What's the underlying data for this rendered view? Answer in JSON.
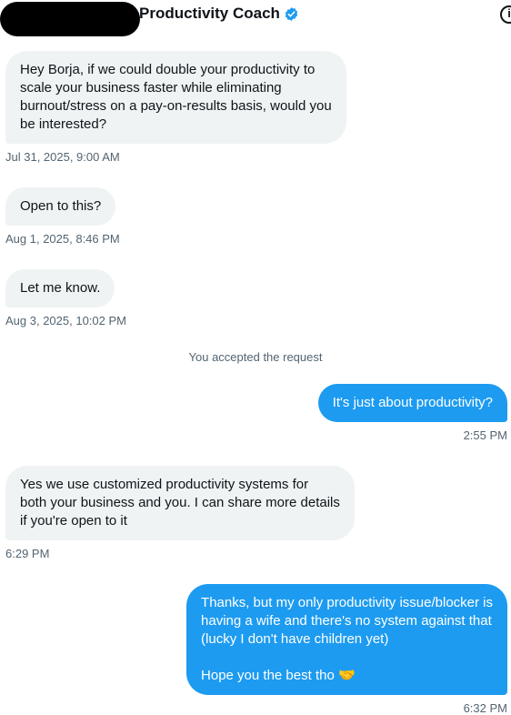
{
  "header": {
    "name": "Productivity Coach",
    "verified_icon": "verified-badge-icon",
    "info_icon": "info-icon"
  },
  "colors": {
    "accent": "#1d9bf0",
    "incoming_bg": "#eff3f4",
    "timestamp": "#536471"
  },
  "messages": [
    {
      "direction": "in",
      "lines": [
        "Hey Borja, if we could double your productivity to",
        "scale your business faster while eliminating",
        "burnout/stress on a pay-on-results basis, would you",
        "be interested?"
      ],
      "time": "Jul 31, 2025, 9:00 AM"
    },
    {
      "direction": "in",
      "lines": [
        "Open to this?"
      ],
      "time": "Aug 1, 2025, 8:46 PM"
    },
    {
      "direction": "in",
      "lines": [
        "Let me know."
      ],
      "time": "Aug 3, 2025, 10:02 PM"
    },
    {
      "system": "You accepted the request"
    },
    {
      "direction": "out",
      "lines": [
        "It's just about productivity?"
      ],
      "time": "2:55 PM"
    },
    {
      "direction": "in",
      "lines": [
        "Yes we use customized productivity systems for",
        "both your business and you. I can share more details",
        "if you're open to it"
      ],
      "time": "6:29 PM"
    },
    {
      "direction": "out",
      "lines": [
        "Thanks, but my only productivity issue/blocker is",
        "having a wife and there's no system against that",
        "(lucky I don't have children yet)",
        "",
        "Hope you the best tho 🤝"
      ],
      "time": "6:32 PM"
    }
  ]
}
